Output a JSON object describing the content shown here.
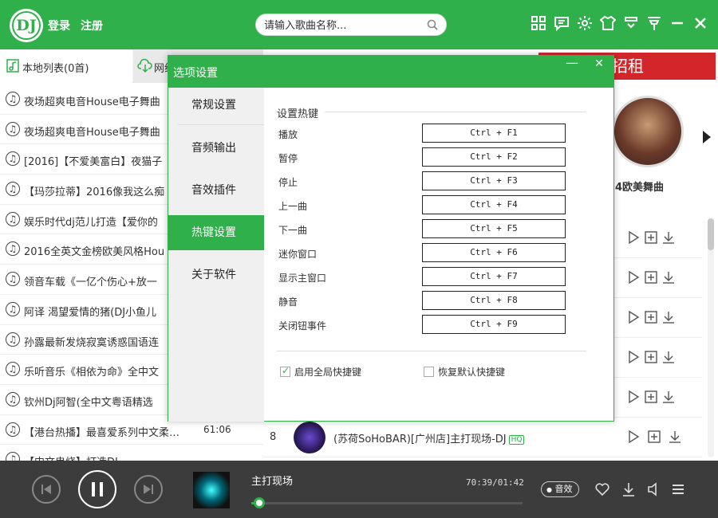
{
  "header": {
    "logo_text": "DJ",
    "login_label": "登录",
    "register_label": "注册",
    "search_placeholder": "请输入歌曲名称...",
    "accent_color": "#2fb04a"
  },
  "left_panel": {
    "tab_local": "本地列表(0首)",
    "tab_net": "网络",
    "songs": [
      {
        "title": "夜场超爽电音House电子舞曲",
        "duration": ""
      },
      {
        "title": "夜场超爽电音House电子舞曲",
        "duration": ""
      },
      {
        "title": "[2016]【不爱美富白】夜猫子",
        "duration": ""
      },
      {
        "title": "【玛莎拉蒂】2016像我这么痴",
        "duration": ""
      },
      {
        "title": "娱乐时代dj范儿打造【爱你的",
        "duration": ""
      },
      {
        "title": "2016全英文金榜欧美风格Hou",
        "duration": ""
      },
      {
        "title": "领音车载《一亿个伤心+放一",
        "duration": ""
      },
      {
        "title": "阿译  渴望爱情的猪(DJ小鱼儿",
        "duration": ""
      },
      {
        "title": "孙露最新发烧寂寞诱惑国语连",
        "duration": ""
      },
      {
        "title": "乐听音乐《相依为命》全中文",
        "duration": ""
      },
      {
        "title": "钦州Dj阿智(全中文粤语精选",
        "duration": ""
      },
      {
        "title": "【港台热播】最喜爱系列中文柔…",
        "duration": "61:06"
      },
      {
        "title": "【中文串烧】打造DJ…",
        "duration": ""
      }
    ]
  },
  "right_panel": {
    "ad_text": "金广告位招租",
    "cover_label": "4欧美舞曲",
    "track8": {
      "number": "8",
      "title": "(苏荷SoHoBAR)[广州店]主打现场-DJ",
      "badge": "HQ"
    }
  },
  "dialog": {
    "title": "选项设置",
    "minimize": "—",
    "close": "✕",
    "nav": [
      "常规设置",
      "音频输出",
      "音效插件",
      "热键设置",
      "关于软件"
    ],
    "active_nav": "热键设置",
    "section_title": "设置热键",
    "hotkeys": [
      {
        "label": "播放",
        "key": "Ctrl + F1"
      },
      {
        "label": "暂停",
        "key": "Ctrl + F2"
      },
      {
        "label": "停止",
        "key": "Ctrl + F3"
      },
      {
        "label": "上一曲",
        "key": "Ctrl + F4"
      },
      {
        "label": "下一曲",
        "key": "Ctrl + F5"
      },
      {
        "label": "迷你窗口",
        "key": "Ctrl + F6"
      },
      {
        "label": "显示主窗口",
        "key": "Ctrl + F7"
      },
      {
        "label": "静音",
        "key": "Ctrl + F8"
      },
      {
        "label": "关闭钮事件",
        "key": "Ctrl + F9"
      }
    ],
    "enable_global": {
      "label": "启用全局快捷键",
      "checked": true
    },
    "restore_default": {
      "label": "恢复默认快捷键",
      "checked": false
    }
  },
  "player": {
    "now_playing": "主打现场",
    "time": "70:39/01:42",
    "progress_fraction": 0.03,
    "fx_label": "音效"
  }
}
